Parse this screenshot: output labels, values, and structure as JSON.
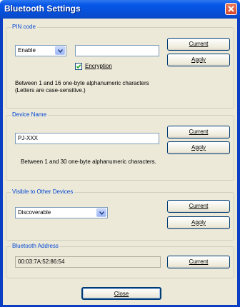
{
  "window": {
    "title": "Bluetooth Settings"
  },
  "pin_code": {
    "group_label": "PIN code",
    "mode_value": "Enable",
    "pin_value": "",
    "encryption_label": "Encryption",
    "encryption_checked": true,
    "help_line1": "Between 1 and 16 one-byte alphanumeric characters",
    "help_line2": "(Letters are case-sensitive.)",
    "current_label": "Current",
    "apply_label": "Apply"
  },
  "device_name": {
    "group_label": "Device Name",
    "value": "PJ-XXX",
    "help": "Between 1 and 30 one-byte alphanumeric characters.",
    "current_label": "Current",
    "apply_label": "Apply"
  },
  "visibility": {
    "group_label": "Visible to Other Devices",
    "value": "Discoverable",
    "current_label": "Current",
    "apply_label": "Apply"
  },
  "bt_address": {
    "group_label": "Bluetooth Address",
    "value": "00:03:7A:52:86:54",
    "current_label": "Current"
  },
  "footer": {
    "close_label": "Close"
  },
  "icons": {
    "close": "close-icon",
    "dropdown": "chevron-down-icon",
    "check": "check-icon"
  },
  "colors": {
    "titlebar": "#0857e8",
    "group_label": "#0046d5",
    "dialog_bg": "#ece9d8",
    "close_button": "#d6452a"
  }
}
